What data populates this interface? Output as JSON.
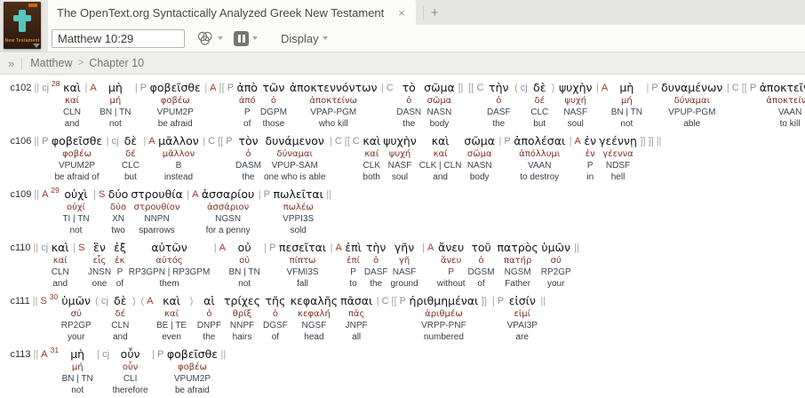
{
  "tab": {
    "title": "The OpenText.org Syntactically Analyzed Greek New Testament",
    "close_glyph": "×",
    "new_tab_glyph": "+"
  },
  "cover": {
    "label": "New Testament"
  },
  "toolbar": {
    "reference_value": "Matthew 10:29",
    "display_label": "Display"
  },
  "breadcrumb": {
    "expander": "»",
    "book": "Matthew",
    "separator": ">",
    "chapter": "Chapter 10"
  },
  "colors": {
    "clause_id": "#2f2f3a",
    "bracket_gray": "#a4a49c",
    "function_blue": "#8292a8",
    "function_red": "#a33b2b",
    "verse_number": "#8c2f1f",
    "greek_text": "#151515",
    "lemma": "#7d3125",
    "morphology": "#3c4553",
    "gloss": "#3a3a38"
  },
  "rows": [
    {
      "units": [
        {
          "pre": [
            [
              "c102",
              "id"
            ],
            [
              "||",
              "p"
            ],
            [
              "cj",
              "b"
            ],
            [
              "28",
              "v"
            ]
          ],
          "greek": "καὶ",
          "lemma": "καί",
          "morph": "CLN",
          "gloss": "and"
        },
        {
          "pre": [
            [
              "|",
              "p"
            ],
            [
              "A",
              "r"
            ]
          ],
          "greek": "μὴ",
          "lemma": "μή",
          "morph": "BN | TN",
          "gloss": "not"
        },
        {
          "pre": [
            [
              "|",
              "p"
            ],
            [
              "P",
              "b"
            ]
          ],
          "greek": "φοβεῖσθε",
          "lemma": "φοβέω",
          "morph": "VPUM2P",
          "gloss": "be afraid"
        },
        {
          "pre": [
            [
              "|",
              "p"
            ],
            [
              "A",
              "r"
            ],
            [
              "[[",
              "p"
            ],
            [
              "P",
              "b"
            ]
          ],
          "greek": "ἀπὸ",
          "lemma": "ἀπό",
          "morph": "P",
          "gloss": "of"
        },
        {
          "greek": "τῶν",
          "lemma": "ὁ",
          "morph": "DGPM",
          "gloss": "those"
        },
        {
          "greek": "ἀποκτεννόντων",
          "lemma": "ἀποκτείνω",
          "morph": "VPAP-PGM",
          "gloss": "who kill"
        },
        {
          "pre": [
            [
              "|",
              "p"
            ],
            [
              "C",
              "b"
            ]
          ],
          "greek": "τὸ",
          "lemma": "ὁ",
          "morph": "DASN",
          "gloss": "the"
        },
        {
          "greek": "σῶμα",
          "lemma": "σῶμα",
          "morph": "NASN",
          "gloss": "body",
          "post": [
            [
              "]]",
              "p"
            ]
          ]
        },
        {
          "pre": [
            [
              "[[",
              "p"
            ],
            [
              "C",
              "b"
            ]
          ],
          "greek": "τὴν",
          "lemma": "ὁ",
          "morph": "DASF",
          "gloss": "the"
        },
        {
          "pre": [
            [
              "(",
              "p"
            ],
            [
              "cj",
              "b"
            ]
          ],
          "greek": "δὲ",
          "lemma": "δέ",
          "morph": "CLC",
          "gloss": "but",
          "post": [
            [
              ")",
              "p"
            ]
          ]
        },
        {
          "greek": "ψυχὴν",
          "lemma": "ψυχή",
          "morph": "NASF",
          "gloss": "soul"
        },
        {
          "pre": [
            [
              "|",
              "p"
            ],
            [
              "A",
              "r"
            ]
          ],
          "greek": "μὴ",
          "lemma": "μή",
          "morph": "BN | TN",
          "gloss": "not"
        },
        {
          "pre": [
            [
              "|",
              "p"
            ],
            [
              "P",
              "b"
            ]
          ],
          "greek": "δυναμένων",
          "lemma": "δύναμαι",
          "morph": "VPUP-PGM",
          "gloss": "able"
        },
        {
          "pre": [
            [
              "|",
              "p"
            ],
            [
              "C",
              "b"
            ],
            [
              "[[",
              "p"
            ],
            [
              "P",
              "b"
            ]
          ],
          "greek": "ἀποκτεῖναι",
          "lemma": "ἀποκτείνω",
          "morph": "VAAN",
          "gloss": "to kill",
          "post": [
            [
              "]]",
              "p"
            ],
            [
              "]]",
              "p"
            ],
            [
              "||",
              "p"
            ]
          ]
        }
      ]
    },
    {
      "units": [
        {
          "pre": [
            [
              "c106",
              "id"
            ],
            [
              "||",
              "p"
            ],
            [
              "P",
              "b"
            ]
          ],
          "greek": "φοβεῖσθε",
          "lemma": "φοβέω",
          "morph": "VPUM2P",
          "gloss": "be afraid of"
        },
        {
          "pre": [
            [
              "|",
              "p"
            ],
            [
              "cj",
              "b"
            ]
          ],
          "greek": "δὲ",
          "lemma": "δέ",
          "morph": "CLC",
          "gloss": "but"
        },
        {
          "pre": [
            [
              "|",
              "p"
            ],
            [
              "A",
              "r"
            ]
          ],
          "greek": "μᾶλλον",
          "lemma": "μᾶλλον",
          "morph": "B",
          "gloss": "instead"
        },
        {
          "pre": [
            [
              "|",
              "p"
            ],
            [
              "C",
              "b"
            ],
            [
              "[[",
              "p"
            ],
            [
              "P",
              "b"
            ]
          ],
          "greek": "τὸν",
          "lemma": "ὁ",
          "morph": "DASM",
          "gloss": "the"
        },
        {
          "greek": "δυνάμενον",
          "lemma": "δύναμαι",
          "morph": "VPUP-SAM",
          "gloss": "one who is able"
        },
        {
          "pre": [
            [
              "|",
              "p"
            ],
            [
              "C",
              "b"
            ],
            [
              "[[",
              "p"
            ],
            [
              "C",
              "b"
            ]
          ],
          "greek": "καὶ",
          "lemma": "καί",
          "morph": "CLK",
          "gloss": "both"
        },
        {
          "greek": "ψυχὴν",
          "lemma": "ψυχή",
          "morph": "NASF",
          "gloss": "soul"
        },
        {
          "greek": "καὶ",
          "lemma": "καί",
          "morph": "CLK | CLN",
          "gloss": "and"
        },
        {
          "greek": "σῶμα",
          "lemma": "σῶμα",
          "morph": "NASN",
          "gloss": "body"
        },
        {
          "pre": [
            [
              "|",
              "p"
            ],
            [
              "P",
              "b"
            ]
          ],
          "greek": "ἀπολέσαι",
          "lemma": "ἀπόλλυμι",
          "morph": "VAAN",
          "gloss": "to destroy"
        },
        {
          "pre": [
            [
              "|",
              "p"
            ],
            [
              "A",
              "r"
            ]
          ],
          "greek": "ἐν",
          "lemma": "ἐν",
          "morph": "P",
          "gloss": "in"
        },
        {
          "greek": "γεέννῃ",
          "lemma": "γέεννα",
          "morph": "NDSF",
          "gloss": "hell",
          "post": [
            [
              "]]",
              "p"
            ],
            [
              "]]",
              "p"
            ],
            [
              "||",
              "p"
            ]
          ]
        }
      ]
    },
    {
      "units": [
        {
          "pre": [
            [
              "c109",
              "id"
            ],
            [
              "||",
              "p"
            ],
            [
              "A",
              "r"
            ],
            [
              "29",
              "v"
            ]
          ],
          "greek": "οὐχὶ",
          "lemma": "οὐχί",
          "morph": "TI | TN",
          "gloss": "not"
        },
        {
          "pre": [
            [
              "|",
              "p"
            ],
            [
              "S",
              "r"
            ]
          ],
          "greek": "δύο",
          "lemma": "δύο",
          "morph": "XN",
          "gloss": "two"
        },
        {
          "greek": "στρουθία",
          "lemma": "στρουθίον",
          "morph": "NNPN",
          "gloss": "sparrows"
        },
        {
          "pre": [
            [
              "|",
              "p"
            ],
            [
              "A",
              "r"
            ]
          ],
          "greek": "ἀσσαρίου",
          "lemma": "ἀσσάριον",
          "morph": "NGSN",
          "gloss": "for a penny"
        },
        {
          "pre": [
            [
              "|",
              "p"
            ],
            [
              "P",
              "b"
            ]
          ],
          "greek": "πωλεῖται",
          "lemma": "πωλέω",
          "morph": "VPPI3S",
          "gloss": "sold",
          "post": [
            [
              "||",
              "p"
            ]
          ]
        }
      ]
    },
    {
      "units": [
        {
          "pre": [
            [
              "c110",
              "id"
            ],
            [
              "||",
              "p"
            ],
            [
              "cj",
              "b"
            ]
          ],
          "greek": "καὶ",
          "lemma": "καί",
          "morph": "CLN",
          "gloss": "and"
        },
        {
          "pre": [
            [
              "|",
              "p"
            ],
            [
              "S",
              "r"
            ]
          ],
          "greek": "ἓν",
          "lemma": "εἷς",
          "morph": "JNSN",
          "gloss": "one"
        },
        {
          "greek": "ἐξ",
          "lemma": "ἐκ",
          "morph": "P",
          "gloss": "of"
        },
        {
          "greek": "αὐτῶν",
          "lemma": "αὐτός",
          "morph": "RP3GPN | RP3GPM",
          "gloss": "them"
        },
        {
          "pre": [
            [
              "|",
              "p"
            ],
            [
              "A",
              "r"
            ]
          ],
          "greek": "οὐ",
          "lemma": "οὐ",
          "morph": "BN | TN",
          "gloss": "not"
        },
        {
          "pre": [
            [
              "|",
              "p"
            ],
            [
              "P",
              "b"
            ]
          ],
          "greek": "πεσεῖται",
          "lemma": "πίπτω",
          "morph": "VFMI3S",
          "gloss": "fall"
        },
        {
          "pre": [
            [
              "|",
              "p"
            ],
            [
              "A",
              "r"
            ]
          ],
          "greek": "ἐπὶ",
          "lemma": "ἐπί",
          "morph": "P",
          "gloss": "to"
        },
        {
          "greek": "τὴν",
          "lemma": "ὁ",
          "morph": "DASF",
          "gloss": "the"
        },
        {
          "greek": "γῆν",
          "lemma": "γῆ",
          "morph": "NASF",
          "gloss": "ground"
        },
        {
          "pre": [
            [
              "|",
              "p"
            ],
            [
              "A",
              "r"
            ]
          ],
          "greek": "ἄνευ",
          "lemma": "ἄνευ",
          "morph": "P",
          "gloss": "without"
        },
        {
          "greek": "τοῦ",
          "lemma": "ὁ",
          "morph": "DGSM",
          "gloss": "of"
        },
        {
          "greek": "πατρὸς",
          "lemma": "πατήρ",
          "morph": "NGSM",
          "gloss": "Father"
        },
        {
          "greek": "ὑμῶν",
          "lemma": "σύ",
          "morph": "RP2GP",
          "gloss": "your",
          "post": [
            [
              "||",
              "p"
            ]
          ]
        }
      ]
    },
    {
      "units": [
        {
          "pre": [
            [
              "c111",
              "id"
            ],
            [
              "||",
              "p"
            ],
            [
              "S",
              "r"
            ],
            [
              "30",
              "v"
            ]
          ],
          "greek": "ὑμῶν",
          "lemma": "σύ",
          "morph": "RP2GP",
          "gloss": "your"
        },
        {
          "pre": [
            [
              "(",
              "p"
            ],
            [
              "cj",
              "b"
            ]
          ],
          "greek": "δὲ",
          "lemma": "δέ",
          "morph": "CLN",
          "gloss": "and",
          "post": [
            [
              ")",
              "p"
            ]
          ]
        },
        {
          "pre": [
            [
              "(",
              "p"
            ],
            [
              "A",
              "r"
            ]
          ],
          "greek": "καὶ",
          "lemma": "καί",
          "morph": "BE | TE",
          "gloss": "even",
          "post": [
            [
              ")",
              "p"
            ]
          ]
        },
        {
          "greek": "αἱ",
          "lemma": "ὁ",
          "morph": "DNPF",
          "gloss": "the"
        },
        {
          "greek": "τρίχες",
          "lemma": "θρίξ",
          "morph": "NNPF",
          "gloss": "hairs"
        },
        {
          "greek": "τῆς",
          "lemma": "ὁ",
          "morph": "DGSF",
          "gloss": "of"
        },
        {
          "greek": "κεφαλῆς",
          "lemma": "κεφαλή",
          "morph": "NGSF",
          "gloss": "head"
        },
        {
          "greek": "πᾶσαι",
          "lemma": "πᾶς",
          "morph": "JNPF",
          "gloss": "all"
        },
        {
          "pre": [
            [
              "|",
              "p"
            ],
            [
              "C",
              "b"
            ],
            [
              "[[",
              "p"
            ],
            [
              "P",
              "b"
            ]
          ],
          "greek": "ἠριθμημέναι",
          "lemma": "ἀριθμέω",
          "morph": "VRPP-PNF",
          "gloss": "numbered",
          "post": [
            [
              "]]",
              "p"
            ]
          ]
        },
        {
          "pre": [
            [
              "|",
              "p"
            ],
            [
              "P",
              "b"
            ]
          ],
          "greek": "εἰσίν",
          "lemma": "εἰμί",
          "morph": "VPAI3P",
          "gloss": "are",
          "post": [
            [
              "||",
              "p"
            ]
          ]
        }
      ]
    },
    {
      "units": [
        {
          "pre": [
            [
              "c113",
              "id"
            ],
            [
              "||",
              "p"
            ],
            [
              "A",
              "r"
            ],
            [
              "31",
              "v"
            ]
          ],
          "greek": "μὴ",
          "lemma": "μή",
          "morph": "BN | TN",
          "gloss": "not"
        },
        {
          "pre": [
            [
              "|",
              "p"
            ],
            [
              "cj",
              "b"
            ]
          ],
          "greek": "οὖν",
          "lemma": "οὖν",
          "morph": "CLI",
          "gloss": "therefore"
        },
        {
          "pre": [
            [
              "|",
              "p"
            ],
            [
              "P",
              "b"
            ]
          ],
          "greek": "φοβεῖσθε",
          "lemma": "φοβέω",
          "morph": "VPUM2P",
          "gloss": "be afraid",
          "post": [
            [
              "||",
              "p"
            ]
          ]
        }
      ]
    }
  ]
}
